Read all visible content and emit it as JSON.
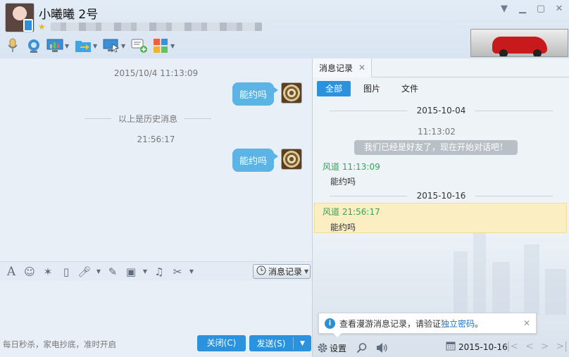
{
  "header": {
    "username": "小曦曦 2号",
    "window_controls": [
      "chevron-down-icon",
      "minimize-icon",
      "maximize-icon",
      "close-icon"
    ]
  },
  "toolbar": {
    "items": [
      {
        "name": "voice-call",
        "has_arrow": false
      },
      {
        "name": "video-call",
        "has_arrow": false
      },
      {
        "name": "screen-share",
        "has_arrow": true
      },
      {
        "name": "send-file",
        "has_arrow": true
      },
      {
        "name": "remote-assist",
        "has_arrow": true
      },
      {
        "name": "create-discussion",
        "has_arrow": false
      },
      {
        "name": "apps",
        "has_arrow": true
      }
    ]
  },
  "chat": {
    "time1": "2015/10/4 11:13:09",
    "msg1": "能约吗",
    "history_divider": "以上是历史消息",
    "time2": "21:56:17",
    "msg2": "能约吗"
  },
  "input": {
    "history_button": "消息记录",
    "ad_text": "每日秒杀，家电抄底，准时开启",
    "close_button": "关闭(C)",
    "send_button": "发送(S)"
  },
  "history_panel": {
    "tab_label": "消息记录",
    "filters": [
      "全部",
      "图片",
      "文件"
    ],
    "date1": "2015-10-04",
    "sys_time": "11:13:02",
    "sys_msg": "我们已经是好友了，现在开始对话吧！",
    "entry1_sender": "风道 11:13:09",
    "entry1_msg": "能约吗",
    "date2": "2015-10-16",
    "entry2_sender": "风道 21:56:17",
    "entry2_msg": "能约吗",
    "notice_text": "查看漫游消息记录，请验证",
    "notice_link": "独立密码",
    "notice_end": "。",
    "settings_label": "设置",
    "current_date": "2015-10-16"
  },
  "colors": {
    "accent": "#2b93dd",
    "bubble": "#5bb3e6",
    "sender_green": "#35a35a",
    "highlight": "#fbeec3"
  }
}
